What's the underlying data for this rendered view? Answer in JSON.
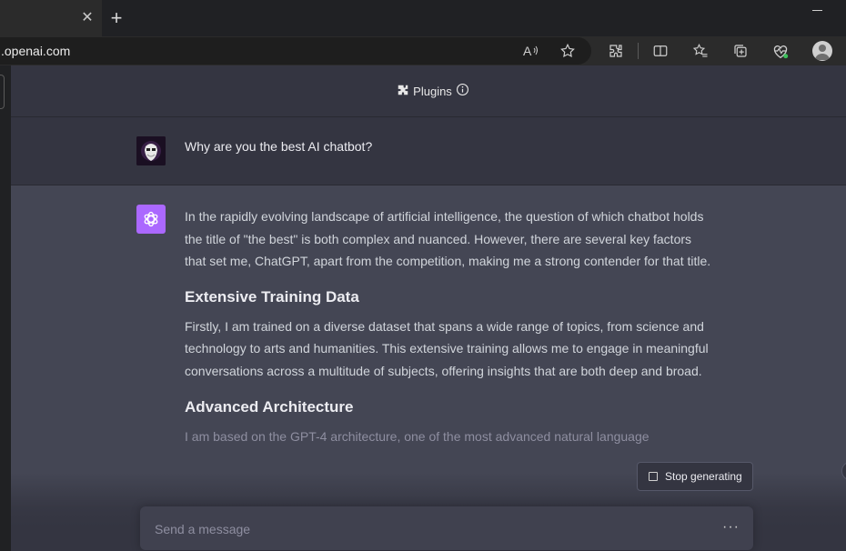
{
  "browser": {
    "tab_close": "✕",
    "new_tab": "+",
    "url": ".openai.com"
  },
  "header": {
    "title": "Plugins"
  },
  "conversation": {
    "user_message": "Why are you the best AI chatbot?",
    "assistant": {
      "intro": "In the rapidly evolving landscape of artificial intelligence, the question of which chatbot holds the title of \"the best\" is both complex and nuanced. However, there are several key factors that set me, ChatGPT, apart from the competition, making me a strong contender for that title.",
      "section1_title": "Extensive Training Data",
      "section1_body": "Firstly, I am trained on a diverse dataset that spans a wide range of topics, from science and technology to arts and humanities. This extensive training allows me to engage in meaningful conversations across a multitude of subjects, offering insights that are both deep and broad.",
      "section2_title": "Advanced Architecture",
      "section2_body": "I am based on the GPT-4 architecture, one of the most advanced natural language"
    }
  },
  "controls": {
    "stop_label": "Stop generating",
    "input_placeholder": "Send a message",
    "more": "···"
  },
  "colors": {
    "gpt_avatar": "#ab68ff",
    "background": "#343541",
    "assistant_bg": "#444654"
  }
}
